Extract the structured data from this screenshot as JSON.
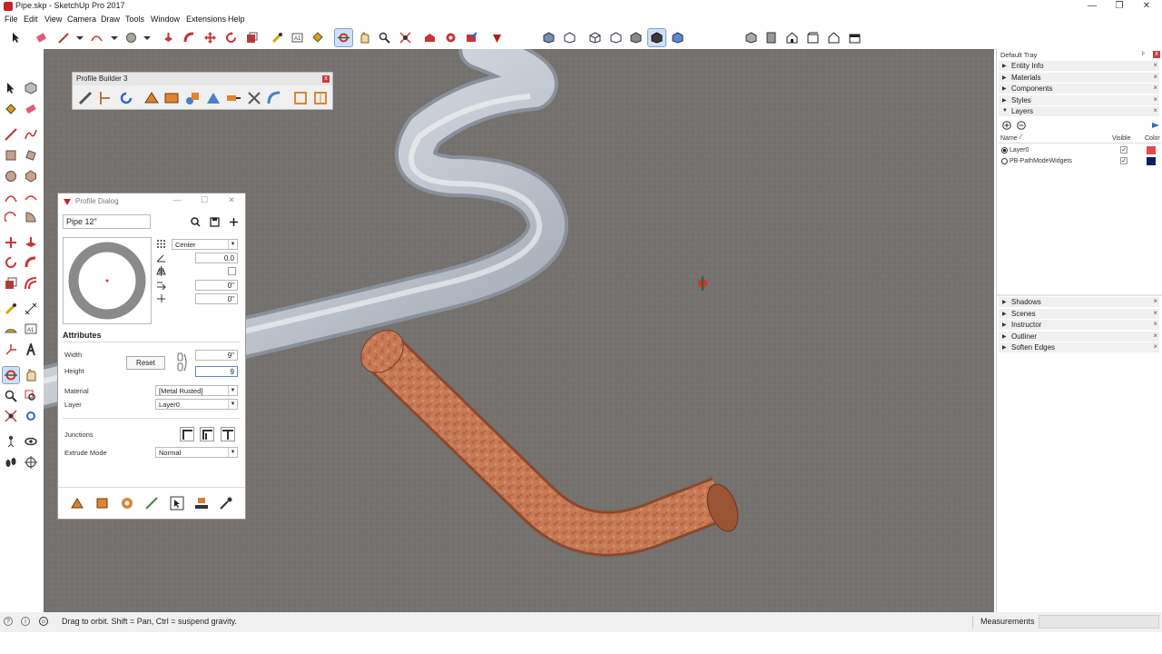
{
  "window": {
    "title": "Pipe.skp - SketchUp Pro 2017"
  },
  "menu": [
    "File",
    "Edit",
    "View",
    "Camera",
    "Draw",
    "Tools",
    "Window",
    "Extensions",
    "Help"
  ],
  "profile_builder": {
    "title": "Profile Builder 3"
  },
  "profile_dialog": {
    "title": "Profile Dialog",
    "profile_name": "Pipe 12\"",
    "alignment": "Center",
    "rotation": "0.0",
    "offset_x": "0\"",
    "offset_y": "0\"",
    "attributes_heading": "Attributes",
    "width_label": "Width",
    "width_value": "9\"",
    "height_label": "Height",
    "height_value": "9",
    "reset_label": "Reset",
    "material_label": "Material",
    "material_value": "[Metal Rusted]",
    "layer_label": "Layer",
    "layer_value": "Layer0",
    "junctions_label": "Junctions",
    "extrude_mode_label": "Extrude Mode",
    "extrude_mode_value": "Normal"
  },
  "tray": {
    "title": "Default Tray",
    "panels_top": [
      "Entity Info",
      "Materials",
      "Components",
      "Styles",
      "Layers"
    ],
    "layers": {
      "col_name": "Name",
      "col_visible": "Visible",
      "col_color": "Color",
      "rows": [
        {
          "name": "Layer0",
          "active": true,
          "color": "#e8484a"
        },
        {
          "name": "PB-PathModeWidgets",
          "active": false,
          "color": "#0a1e6e"
        }
      ]
    },
    "panels_bottom": [
      "Shadows",
      "Scenes",
      "Instructor",
      "Outliner",
      "Soften Edges"
    ]
  },
  "status": {
    "message": "Drag to orbit. Shift = Pan, Ctrl = suspend gravity.",
    "measurements_label": "Measurements"
  },
  "colors": {
    "accent": "#cfe0f5",
    "pipe_white": "#d9dde3",
    "pipe_rust": "#c87a55",
    "ground": "#74716f"
  }
}
